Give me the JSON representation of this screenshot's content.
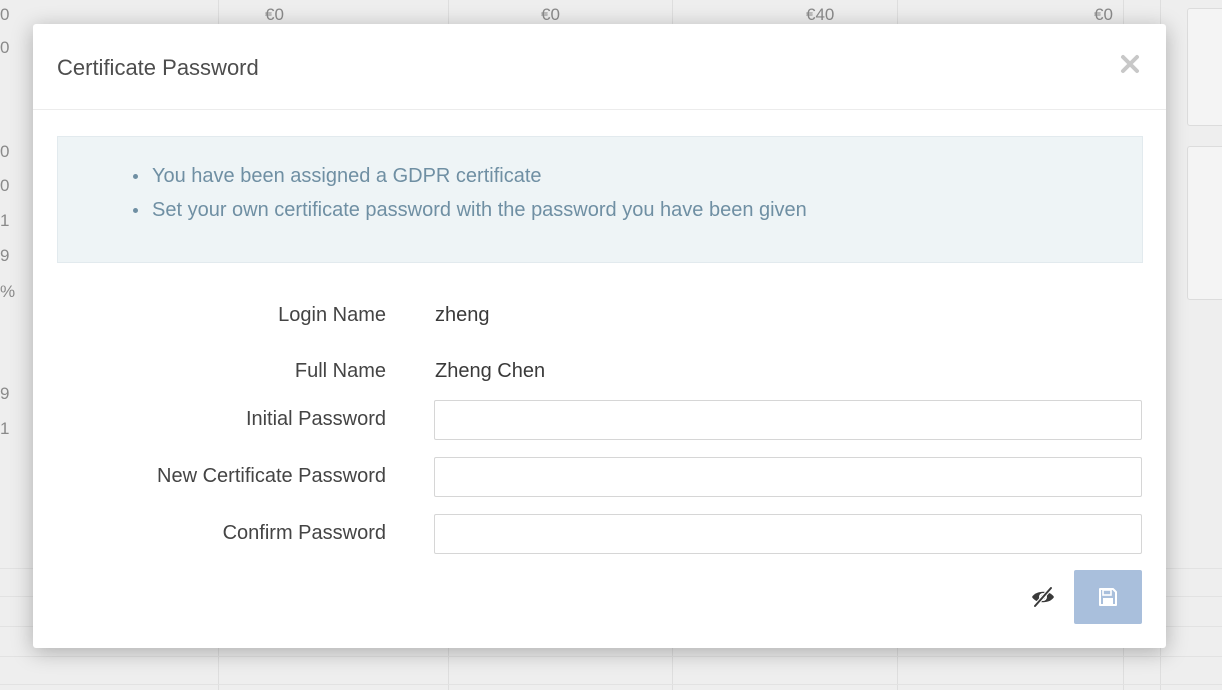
{
  "background": {
    "header_values": [
      "€0",
      "€0",
      "€40",
      "€0"
    ],
    "left_column_values": [
      "0",
      "0",
      "0",
      "0",
      "1",
      "9",
      "%",
      "9",
      "1"
    ]
  },
  "modal": {
    "title": "Certificate Password",
    "close_icon": "close-icon",
    "info_items": [
      "You have been assigned a GDPR certificate",
      "Set your own certificate password with the password you have been given"
    ],
    "fields": {
      "login_name": {
        "label": "Login Name",
        "value": "zheng"
      },
      "full_name": {
        "label": "Full Name",
        "value": "Zheng Chen"
      },
      "initial_password": {
        "label": "Initial Password",
        "value": ""
      },
      "new_certificate_password": {
        "label": "New Certificate Password",
        "value": ""
      },
      "confirm_password": {
        "label": "Confirm Password",
        "value": ""
      }
    },
    "footer": {
      "toggle_icon": "eye-slash-icon",
      "save_icon": "floppy-disk-icon"
    }
  },
  "colors": {
    "info_text": "#6f8fa3",
    "info_background": "#eef4f6",
    "save_button": "#a9bfdc",
    "close_icon": "#c8c8c8"
  }
}
